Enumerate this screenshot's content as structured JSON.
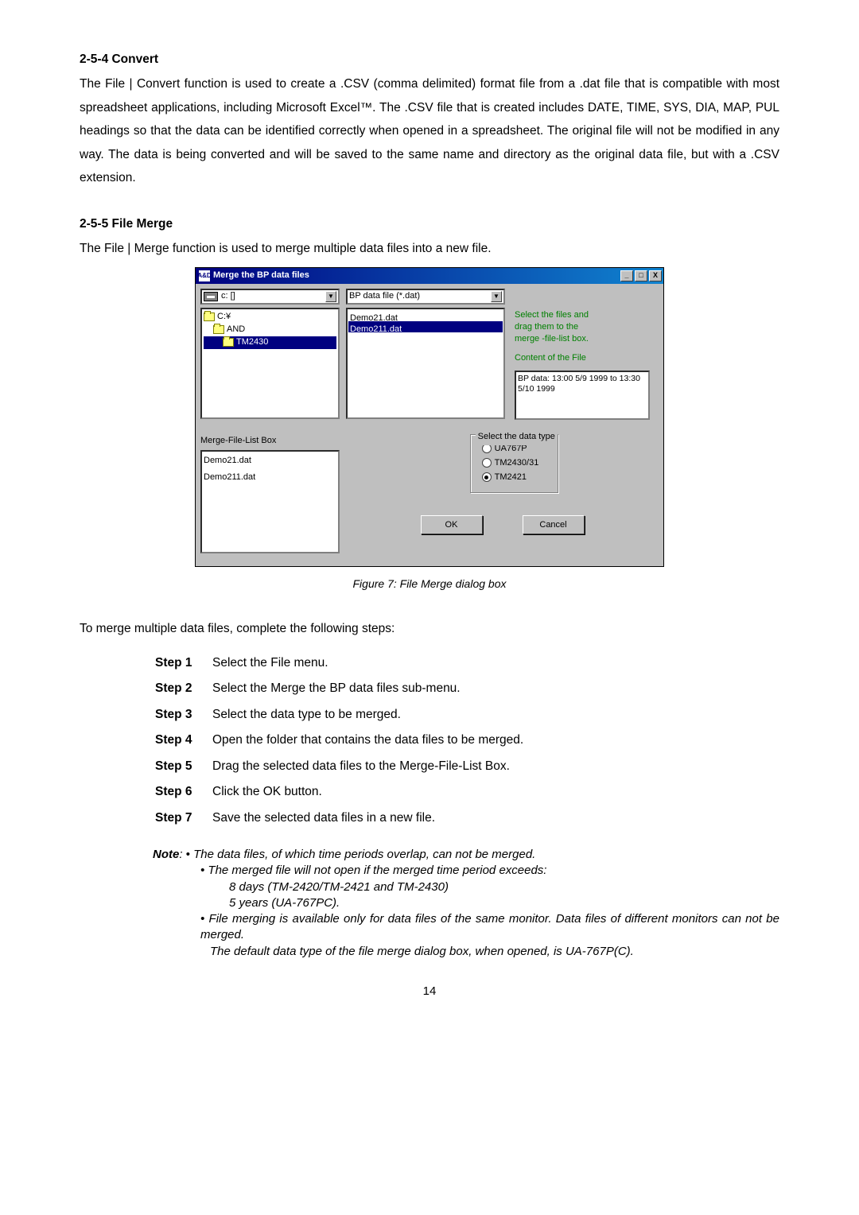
{
  "s1": {
    "heading": "2-5-4 Convert",
    "para": "The File | Convert function is used to create a .CSV (comma delimited) format file from a .dat file that is compatible with most spreadsheet applications, including Microsoft Excel™. The .CSV file that is created includes DATE, TIME, SYS, DIA, MAP, PUL headings so that the data can be identified correctly when opened in a spreadsheet. The original file will not be modified in any way. The data is being converted and will be saved to the same name and directory as the original data file, but with a .CSV extension."
  },
  "s2": {
    "heading": "2-5-5 File Merge",
    "para": "The File | Merge function is used to merge multiple data files into a new file."
  },
  "dialog": {
    "icon_text": "A&D",
    "title": "Merge the BP data files",
    "min_glyph": "_",
    "max_glyph": "□",
    "close_glyph": "X",
    "drive_text": "c: []",
    "filter_text": "BP data file (*.dat)",
    "arrow": "▼",
    "folders": {
      "f0": "C:¥",
      "f1": "AND",
      "f2": "TM2430"
    },
    "files": {
      "f0": "Demo21.dat",
      "f1": "Demo211.dat"
    },
    "info1": "Select the files and",
    "info2": "drag them to the",
    "info3": "merge -file-list box.",
    "info4": "Content of the File",
    "content_line": "BP data:  13:00 5/9 1999 to 13:30 5/10 1999",
    "mf_label": "Merge-File-List Box",
    "mf_items": {
      "i0": "Demo21.dat",
      "i1": "Demo211.dat"
    },
    "group_legend": "Select the data type",
    "radios": {
      "r0": "UA767P",
      "r1": "TM2430/31",
      "r2": "TM2421"
    },
    "ok": "OK",
    "cancel": "Cancel"
  },
  "caption": "Figure 7:  File Merge dialog box",
  "merge_intro": "To merge multiple data files, complete the following steps:",
  "steps": {
    "s1l": "Step 1",
    "s1t": "Select the File menu.",
    "s2l": "Step 2",
    "s2t": "Select the Merge the BP data files sub-menu.",
    "s3l": "Step 3",
    "s3t": "Select the data type to be merged.",
    "s4l": "Step 4",
    "s4t": "Open the folder that contains the data files to be merged.",
    "s5l": "Step 5",
    "s5t": "Drag the selected data files to the Merge-File-List Box.",
    "s6l": "Step 6",
    "s6t": "Click the OK button.",
    "s7l": "Step 7",
    "s7t": "Save the selected data files in a new file."
  },
  "note": {
    "label": "Note",
    "line1": ": • The data files, of which time periods overlap, can not be merged.",
    "b1": "• The merged file will not open if the merged time period exceeds:",
    "b1a": "8 days  (TM-2420/TM-2421 and TM-2430)",
    "b1b": "5 years (UA-767PC).",
    "b2": "• File merging is available only for data files of the same monitor. Data files of different monitors can not be merged.",
    "b3": "The default data type of the file merge dialog box, when opened, is UA-767P(C)."
  },
  "page_num": "14"
}
